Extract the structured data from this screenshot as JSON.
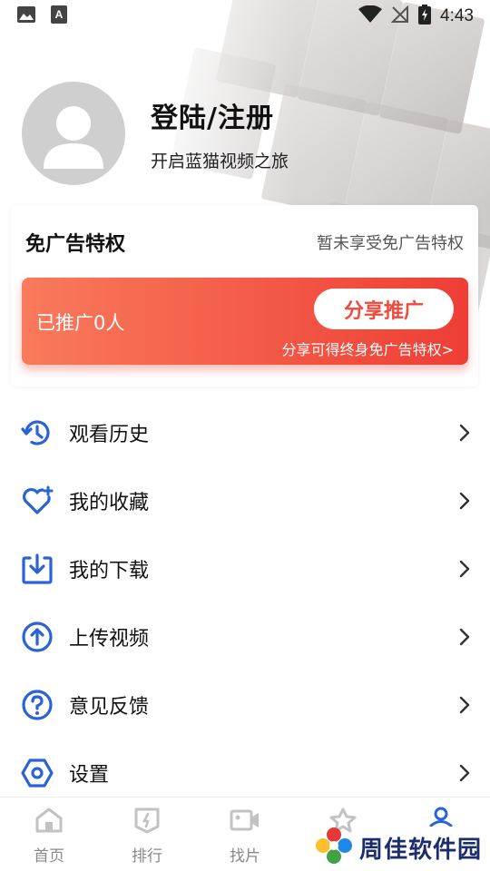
{
  "status_bar": {
    "time": "4:43",
    "icons": [
      "image-icon",
      "text-a-icon",
      "wifi-icon",
      "no-signal-icon",
      "battery-charging-icon"
    ]
  },
  "profile": {
    "title": "登陆/注册",
    "subtitle": "开启蓝猫视频之旅",
    "avatar_icon": "user-avatar-icon"
  },
  "adfree": {
    "title": "免广告特权",
    "status": "暂未享受免广告特权",
    "promo_count": "已推广0人",
    "share_button": "分享推广",
    "promo_note": "分享可得终身免广告特权>",
    "gradient": [
      "#f97a5c",
      "#ee3e35"
    ]
  },
  "menu": [
    {
      "label": "观看历史",
      "icon": "history-icon"
    },
    {
      "label": "我的收藏",
      "icon": "heart-plus-icon"
    },
    {
      "label": "我的下载",
      "icon": "download-icon"
    },
    {
      "label": "上传视频",
      "icon": "upload-icon"
    },
    {
      "label": "意见反馈",
      "icon": "question-icon"
    },
    {
      "label": "设置",
      "icon": "settings-hex-icon"
    }
  ],
  "bottom_nav": [
    {
      "label": "首页",
      "icon": "home-icon"
    },
    {
      "label": "排行",
      "icon": "rank-icon"
    },
    {
      "label": "找片",
      "icon": "video-camera-icon"
    },
    {
      "label": "",
      "icon": "star-icon"
    },
    {
      "label": "",
      "icon": "profile-icon",
      "active": true
    }
  ],
  "colors": {
    "accent": "#2a63d8",
    "promo": "#ee3e35",
    "icon_blue": "#2a63d8"
  },
  "watermark": {
    "text": "周佳软件园"
  }
}
